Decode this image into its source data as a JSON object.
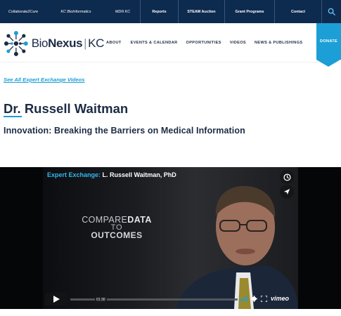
{
  "topbar": {
    "links": [
      {
        "label": "Collaborate2Cure",
        "style": "italic"
      },
      {
        "label": "KC BioInformatics",
        "style": "italic"
      },
      {
        "label": "MDN KC",
        "style": "italic"
      },
      {
        "label": "Reports",
        "style": "bold"
      },
      {
        "label": "STEAM Auction",
        "style": "bold"
      },
      {
        "label": "Grant Programs",
        "style": "bold"
      },
      {
        "label": "Contact",
        "style": "bold"
      }
    ],
    "search_icon": "search-icon"
  },
  "header": {
    "logo": {
      "bio": "Bio",
      "nexus": "Nexus",
      "pipe": "|",
      "kc": "KC",
      "icon": "molecule-icon"
    },
    "nav": [
      "ABOUT",
      "EVENTS & CALENDAR",
      "OPPORTUNITIES",
      "VIDEOS",
      "NEWS & PUBLISHINGS"
    ],
    "donate_label": "DONATE"
  },
  "content": {
    "see_all_link": "See All Expert Exchange Videos",
    "title": "Dr. Russell Waitman",
    "subtitle": "Innovation: Breaking the Barriers on Medical Information"
  },
  "video": {
    "title_prefix": "Expert Exchange:",
    "title_rest": " L. Russell Waitman, PhD",
    "overlay": {
      "line1_a": "COMPARE",
      "line1_b": "DATA",
      "line2": "TO",
      "line3": "OUTCOMES"
    },
    "timecode": "01:30",
    "brand": "vimeo",
    "icons": [
      "clock-icon",
      "send-icon",
      "play-icon",
      "volume-icon",
      "settings-icon",
      "fullscreen-icon"
    ]
  },
  "colors": {
    "navy": "#0d2a4f",
    "accent": "#1c9fd6",
    "text": "#1d2b44"
  }
}
